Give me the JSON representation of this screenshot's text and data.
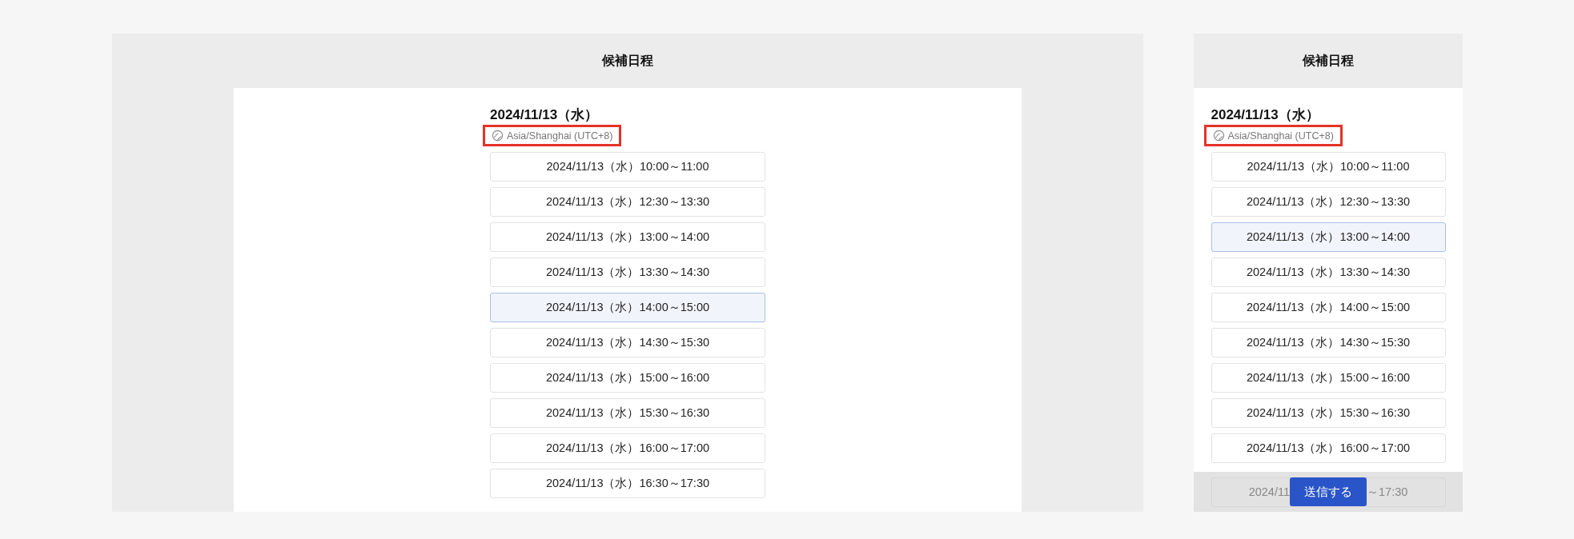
{
  "panels": [
    {
      "kind": "desktop",
      "title": "候補日程",
      "date": "2024/11/13（水）",
      "timezone": "Asia/Shanghai (UTC+8)",
      "highlighted": true,
      "slots": [
        {
          "label": "2024/11/13（水）10:00～11:00",
          "selected": false
        },
        {
          "label": "2024/11/13（水）12:30～13:30",
          "selected": false
        },
        {
          "label": "2024/11/13（水）13:00～14:00",
          "selected": false
        },
        {
          "label": "2024/11/13（水）13:30～14:30",
          "selected": false
        },
        {
          "label": "2024/11/13（水）14:00～15:00",
          "selected": true
        },
        {
          "label": "2024/11/13（水）14:30～15:30",
          "selected": false
        },
        {
          "label": "2024/11/13（水）15:00～16:00",
          "selected": false
        },
        {
          "label": "2024/11/13（水）15:30～16:30",
          "selected": false
        },
        {
          "label": "2024/11/13（水）16:00～17:00",
          "selected": false
        },
        {
          "label": "2024/11/13（水）16:30～17:30",
          "selected": false
        }
      ]
    },
    {
      "kind": "mobile",
      "title": "候補日程",
      "date": "2024/11/13（水）",
      "timezone": "Asia/Shanghai (UTC+8)",
      "highlighted": true,
      "slots": [
        {
          "label": "2024/11/13（水）10:00～11:00",
          "selected": false
        },
        {
          "label": "2024/11/13（水）12:30～13:30",
          "selected": false
        },
        {
          "label": "2024/11/13（水）13:00～14:00",
          "selected": true
        },
        {
          "label": "2024/11/13（水）13:30～14:30",
          "selected": false
        },
        {
          "label": "2024/11/13（水）14:00～15:00",
          "selected": false
        },
        {
          "label": "2024/11/13（水）14:30～15:30",
          "selected": false
        },
        {
          "label": "2024/11/13（水）15:00～16:00",
          "selected": false
        },
        {
          "label": "2024/11/13（水）15:30～16:30",
          "selected": false
        },
        {
          "label": "2024/11/13（水）16:00～17:00",
          "selected": false
        }
      ],
      "footer": {
        "covered_slot_start": "2024/11",
        "covered_slot_end": "～17:30",
        "button": "送信する"
      }
    }
  ]
}
